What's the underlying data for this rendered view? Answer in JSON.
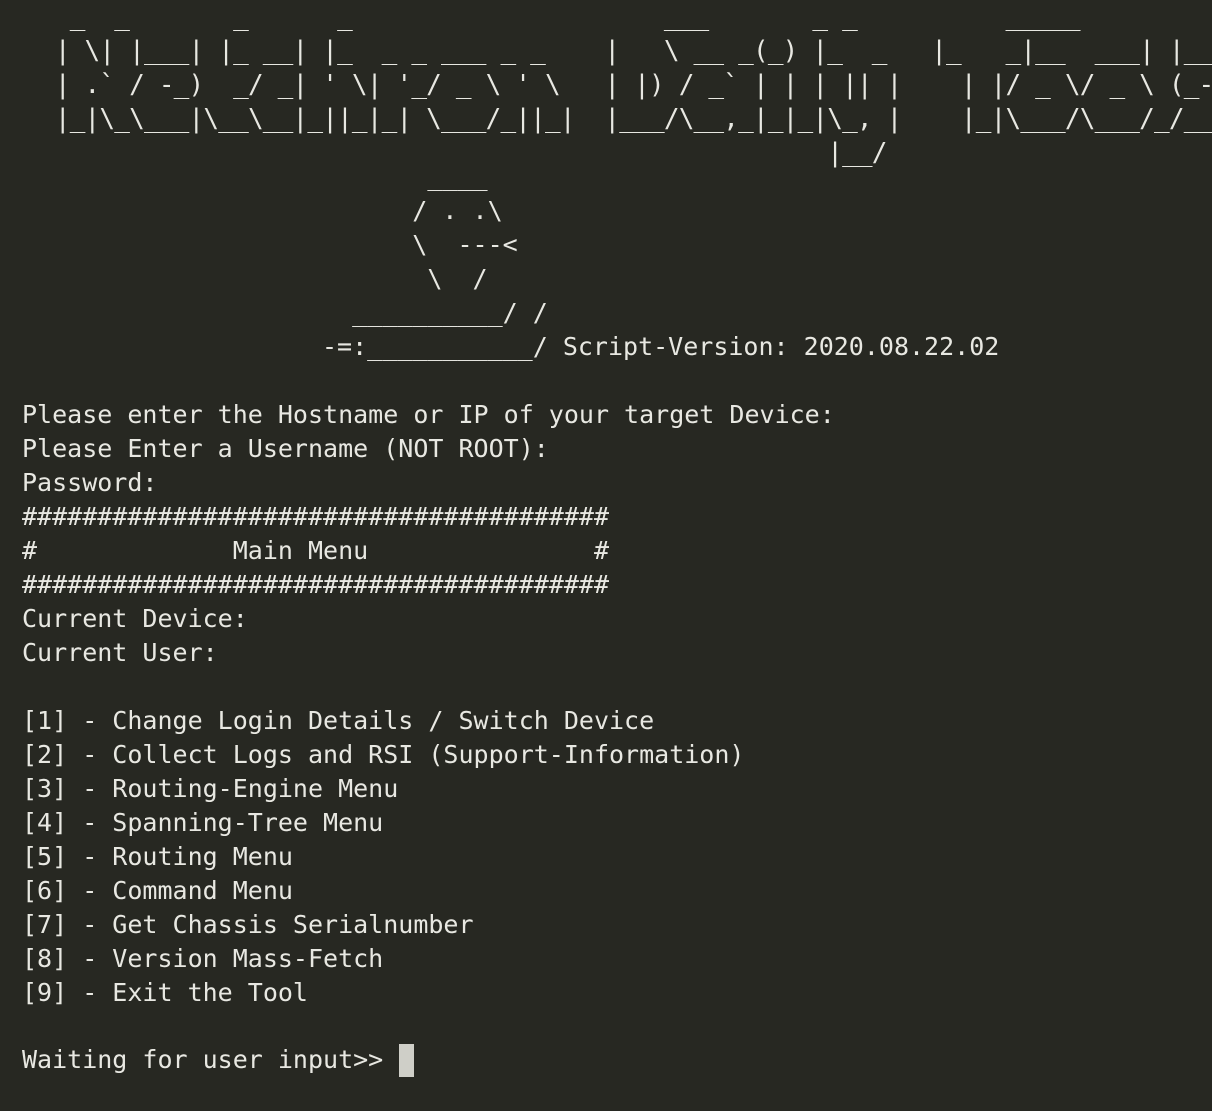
{
  "terminal": {
    "background": "#272822",
    "foreground": "#e8e8e2",
    "banner": [
      "  _  _       _      _                     ___       _ _          _____          _",
      " | \\| |___| |_ __| |_  _ _ ___ _ _    |   \\ __ _(_) |_  _   |_   _|__  ___| |___",
      " | .` / -_)  _/ _| ' \\| '_/ _ \\ ' \\   | |) / _` | | | || |    | |/ _ \\/ _ \\ (_-<",
      " |_|\\_\\___|\\__\\__|_||_|_| \\___/_||_|  |___/\\__,_|_|_|\\_, |    |_|\\___/\\___/_/__/",
      "                                                     |__/"
    ],
    "logo": [
      "       ____",
      "      / . .\\",
      "      \\  ---<",
      "       \\  /",
      "  __________/ /",
      "-=:___________/ Script-Version: 2020.08.22.02"
    ],
    "prompts": {
      "hostname": "Please enter the Hostname or IP of your target Device:",
      "username": "Please Enter a Username (NOT ROOT):",
      "password": "Password:"
    },
    "menu_header": {
      "border": "#######################################",
      "title": "#             Main Menu               #"
    },
    "status": {
      "current_device": "Current Device:",
      "current_user": "Current User:"
    },
    "menu_items": [
      "[1] - Change Login Details / Switch Device",
      "[2] - Collect Logs and RSI (Support-Information)",
      "[3] - Routing-Engine Menu",
      "[4] - Spanning-Tree Menu",
      "[5] - Routing Menu",
      "[6] - Command Menu",
      "[7] - Get Chassis Serialnumber",
      "[8] - Version Mass-Fetch",
      "[9] - Exit the Tool"
    ],
    "input_prompt": "Waiting for user input>>"
  }
}
